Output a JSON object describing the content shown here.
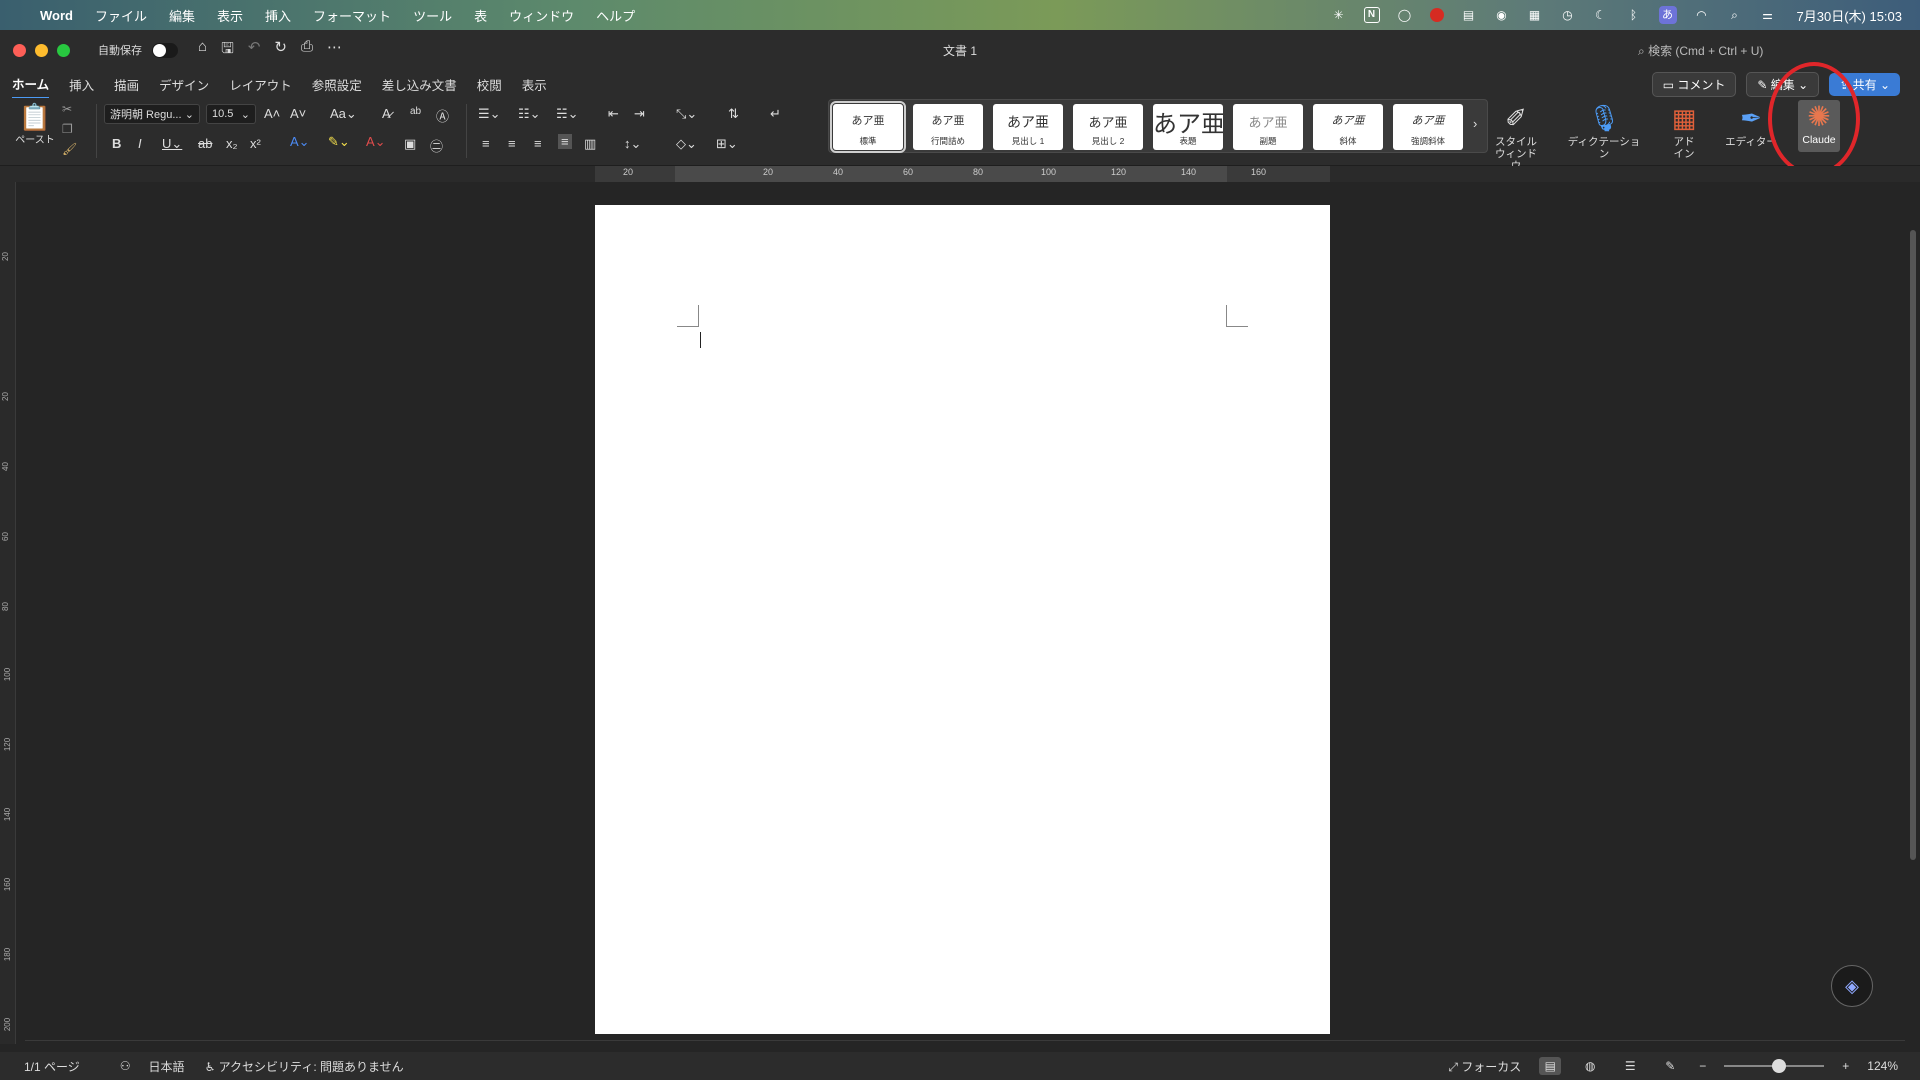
{
  "menubar": {
    "app": "Word",
    "items": [
      "ファイル",
      "編集",
      "表示",
      "挿入",
      "フォーマット",
      "ツール",
      "表",
      "ウィンドウ",
      "ヘルプ"
    ],
    "clock": "7月30日(木) 15:03"
  },
  "titlebar": {
    "autosave_label": "自動保存",
    "doc_title": "文書 1",
    "search_placeholder": "検索 (Cmd + Ctrl + U)"
  },
  "tabs": [
    "ホーム",
    "挿入",
    "描画",
    "デザイン",
    "レイアウト",
    "参照設定",
    "差し込み文書",
    "校閲",
    "表示"
  ],
  "tab_actions": {
    "comment": "コメント",
    "edit": "編集",
    "share": "共有"
  },
  "ribbon": {
    "paste_label": "ペースト",
    "font_name": "游明朝 Regu...",
    "font_size": "10.5",
    "styles": [
      {
        "preview": "あア亜",
        "name": "標準"
      },
      {
        "preview": "あア亜",
        "name": "行間詰め"
      },
      {
        "preview": "あア亜",
        "name": "見出し 1"
      },
      {
        "preview": "あア亜",
        "name": "見出し 2"
      },
      {
        "preview": "あア亜",
        "name": "表題"
      },
      {
        "preview": "あア亜",
        "name": "副題"
      },
      {
        "preview": "あア亜",
        "name": "斜体"
      },
      {
        "preview": "あア亜",
        "name": "強調斜体"
      }
    ],
    "style_window": "スタイル\nウィンドウ",
    "dictation": "ディクテーション",
    "addin": "アド\nイン",
    "editor": "エディター",
    "claude": "Claude"
  },
  "ruler": {
    "h_labels": [
      "20",
      "20",
      "40",
      "60",
      "80",
      "100",
      "120",
      "140",
      "160"
    ],
    "v_labels": [
      "20",
      "20",
      "40",
      "60",
      "80",
      "100",
      "120",
      "140",
      "160",
      "180",
      "200"
    ]
  },
  "status": {
    "pages": "1/1 ページ",
    "language": "日本語",
    "accessibility": "アクセシビリティ: 問題ありません",
    "focus": "フォーカス",
    "zoom": "124%"
  }
}
